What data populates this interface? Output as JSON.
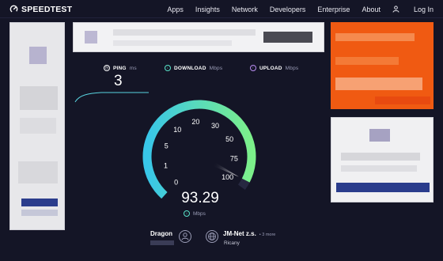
{
  "header": {
    "logo_text": "SPEEDTEST",
    "nav": [
      "Apps",
      "Insights",
      "Network",
      "Developers",
      "Enterprise",
      "About"
    ],
    "login_label": "Log In"
  },
  "metrics": {
    "ping": {
      "label": "PING",
      "unit": "ms",
      "value": "3"
    },
    "download": {
      "label": "DOWNLOAD",
      "unit": "Mbps"
    },
    "upload": {
      "label": "UPLOAD",
      "unit": "Mbps"
    }
  },
  "gauge": {
    "tick_labels": [
      "0",
      "1",
      "5",
      "10",
      "20",
      "30",
      "50",
      "75",
      "100"
    ],
    "speed_value": "93.29",
    "speed_unit": "Mbps",
    "needle_reading": 93.29,
    "colors": {
      "arc_start": "#38c6e8",
      "arc_end": "#7cf08a",
      "track": "#262840"
    }
  },
  "connection": {
    "isp": "Dragon",
    "server": "JM-Net z.s.",
    "server_more": "• 3 more",
    "server_location": "Ricany"
  },
  "icons": {
    "logo": "speedtest-gauge-icon",
    "login": "user-icon",
    "ping": "ping-icon",
    "download": "download-arrow-icon",
    "upload": "upload-arrow-icon",
    "isp": "person-icon",
    "server": "globe-icon"
  }
}
